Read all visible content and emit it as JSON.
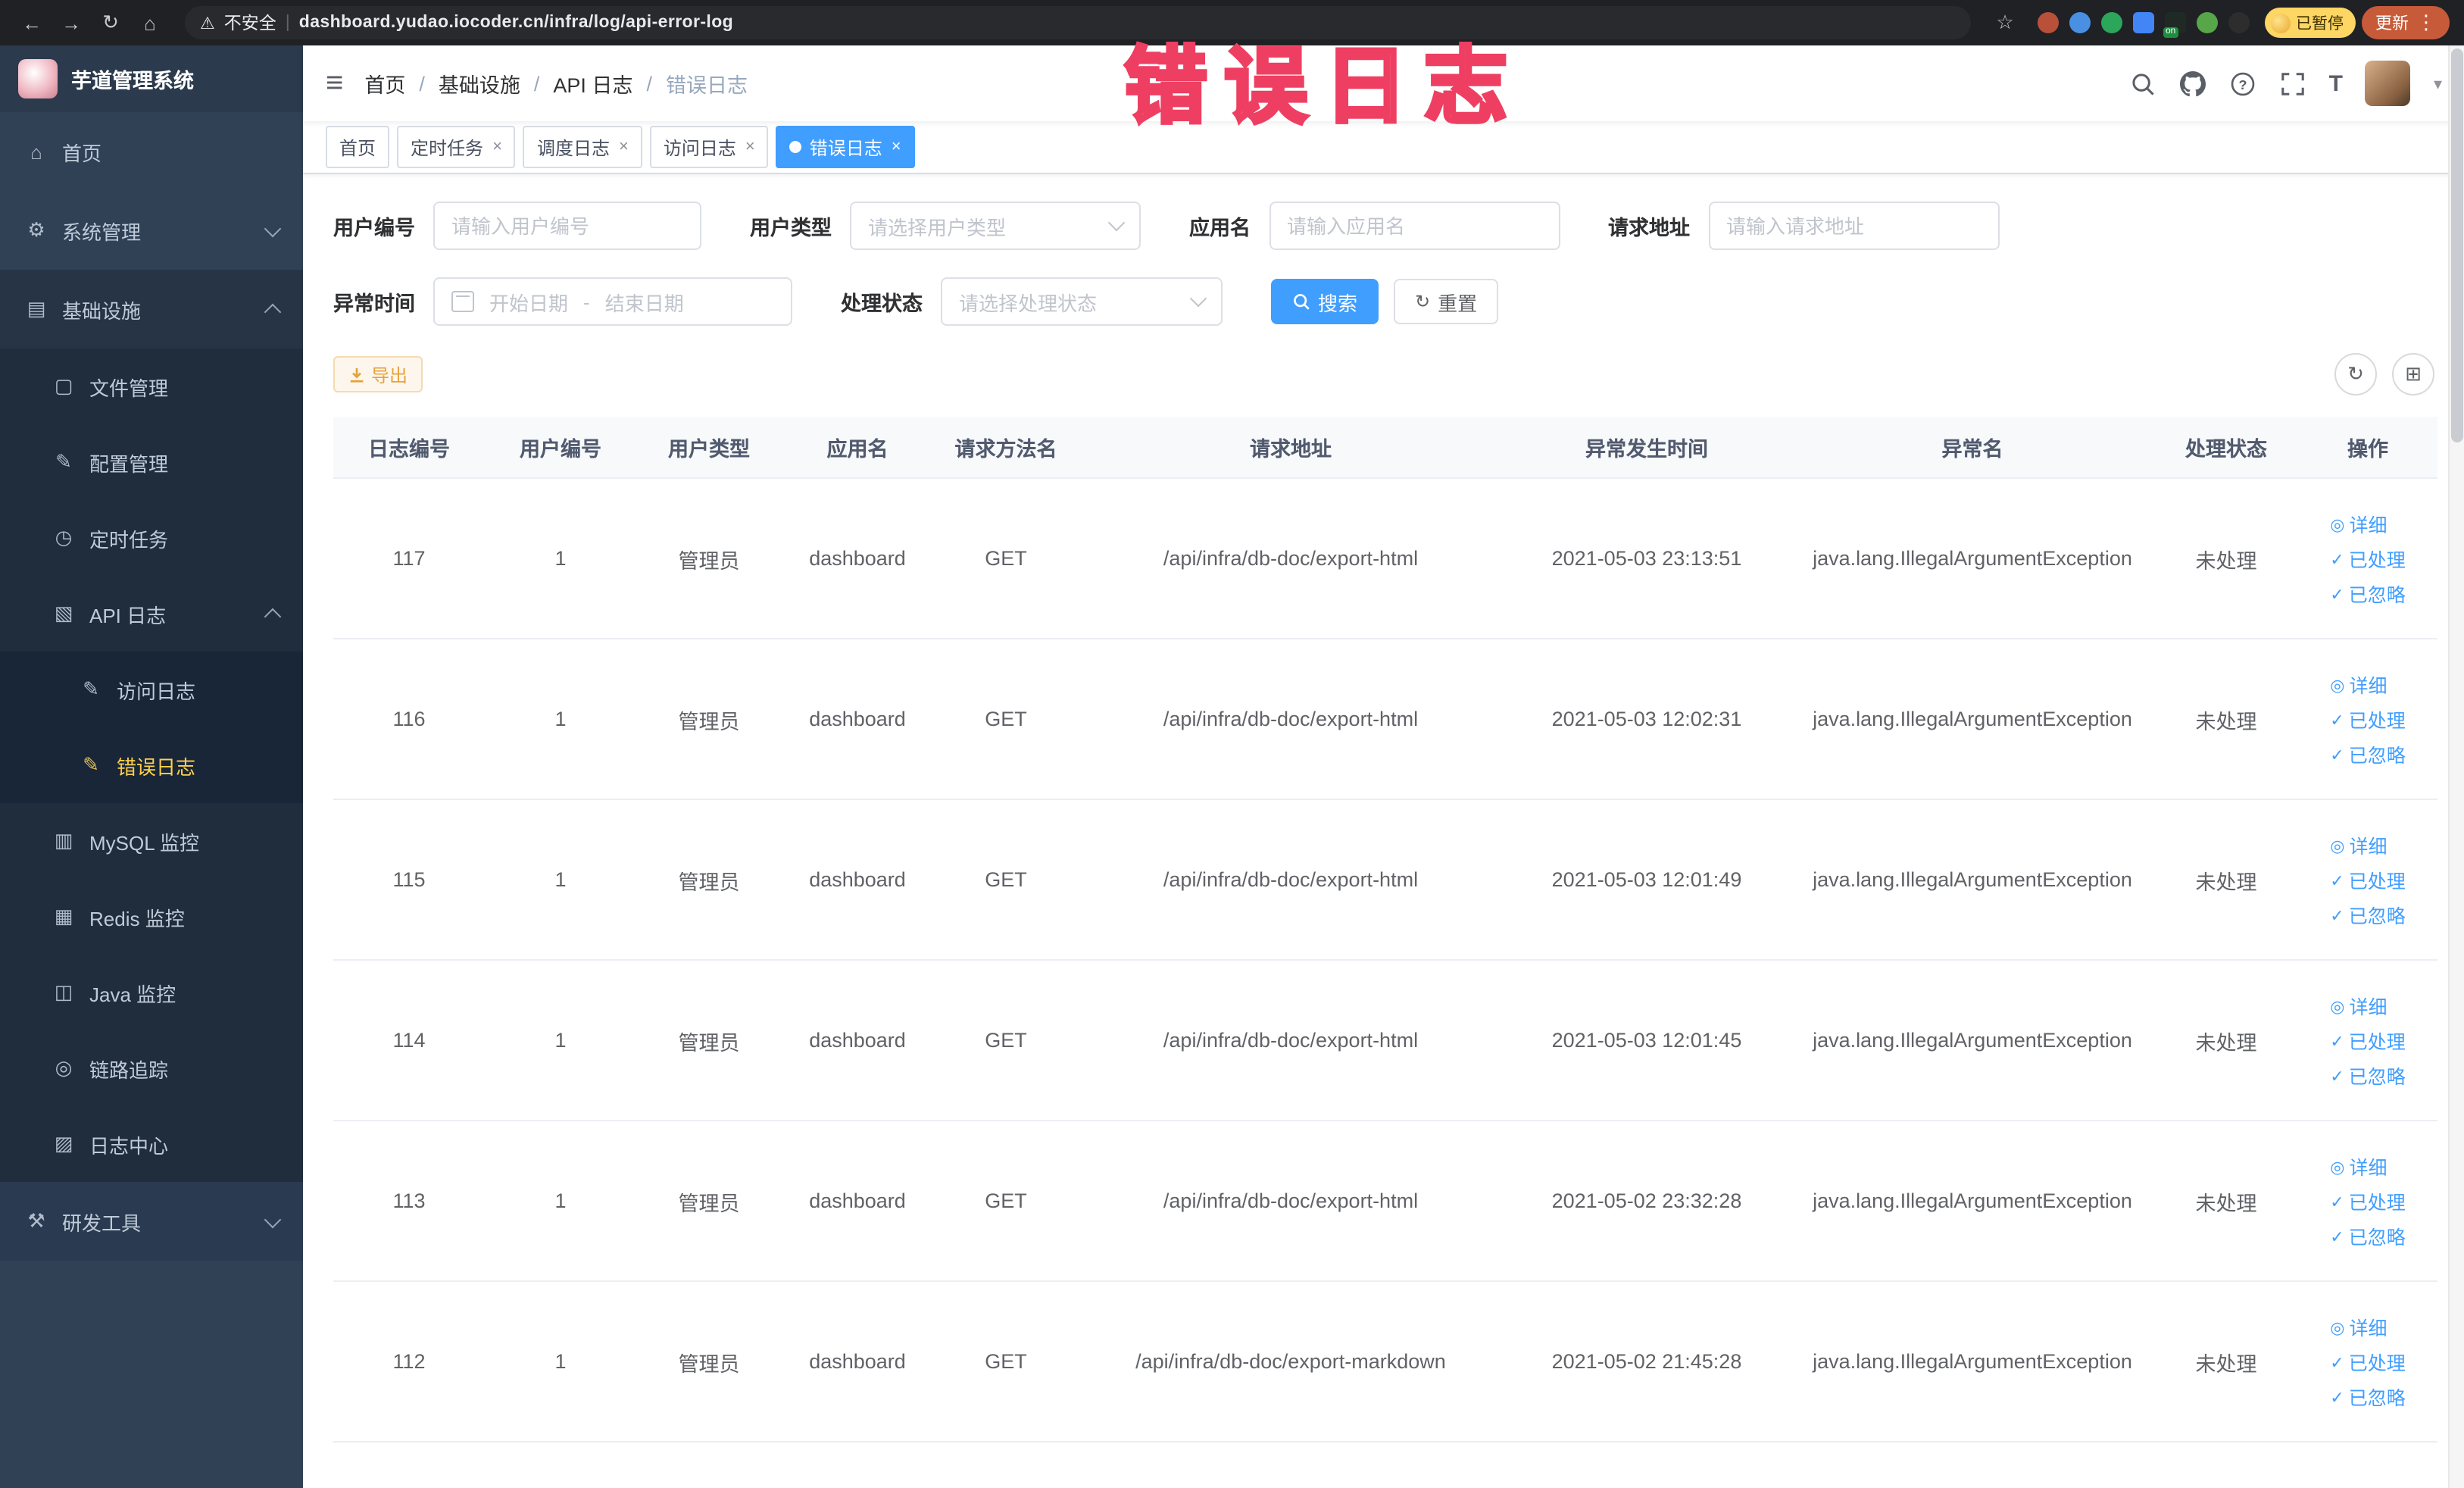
{
  "browser": {
    "security_label": "不安全",
    "url": "dashboard.yudao.iocoder.cn/infra/log/api-error-log",
    "on_badge": "on",
    "paused_badge": "已暂停",
    "update_label": "更新"
  },
  "annotation": {
    "text": "错误日志"
  },
  "sidebar": {
    "title": "芋道管理系统",
    "items": [
      {
        "label": "首页"
      },
      {
        "label": "系统管理"
      },
      {
        "label": "基础设施"
      },
      {
        "label": "文件管理"
      },
      {
        "label": "配置管理"
      },
      {
        "label": "定时任务"
      },
      {
        "label": "API 日志"
      },
      {
        "label": "访问日志"
      },
      {
        "label": "错误日志"
      },
      {
        "label": "MySQL 监控"
      },
      {
        "label": "Redis 监控"
      },
      {
        "label": "Java 监控"
      },
      {
        "label": "链路追踪"
      },
      {
        "label": "日志中心"
      },
      {
        "label": "研发工具"
      }
    ]
  },
  "breadcrumb": [
    "首页",
    "基础设施",
    "API 日志",
    "错误日志"
  ],
  "tags": [
    {
      "label": "首页"
    },
    {
      "label": "定时任务"
    },
    {
      "label": "调度日志"
    },
    {
      "label": "访问日志"
    },
    {
      "label": "错误日志"
    }
  ],
  "filters": {
    "user_id": {
      "label": "用户编号",
      "placeholder": "请输入用户编号"
    },
    "user_type": {
      "label": "用户类型",
      "placeholder": "请选择用户类型"
    },
    "app_name": {
      "label": "应用名",
      "placeholder": "请输入应用名"
    },
    "request_url": {
      "label": "请求地址",
      "placeholder": "请输入请求地址"
    },
    "exception_time": {
      "label": "异常时间",
      "start_placeholder": "开始日期",
      "separator": "-",
      "end_placeholder": "结束日期"
    },
    "process_status": {
      "label": "处理状态",
      "placeholder": "请选择处理状态"
    },
    "search_label": "搜索",
    "reset_label": "重置"
  },
  "toolbar": {
    "export_label": "导出"
  },
  "table": {
    "headers": [
      "日志编号",
      "用户编号",
      "用户类型",
      "应用名",
      "请求方法名",
      "请求地址",
      "异常发生时间",
      "异常名",
      "处理状态",
      "操作"
    ],
    "actions": {
      "detail": "详细",
      "processed": "已处理",
      "ignore": "已忽略"
    },
    "rows": [
      {
        "id": "117",
        "user_id": "1",
        "user_type": "管理员",
        "app": "dashboard",
        "method": "GET",
        "url": "/api/infra/db-doc/export-html",
        "time": "2021-05-03 23:13:51",
        "exception": "java.lang.IllegalArgumentException",
        "status": "未处理"
      },
      {
        "id": "116",
        "user_id": "1",
        "user_type": "管理员",
        "app": "dashboard",
        "method": "GET",
        "url": "/api/infra/db-doc/export-html",
        "time": "2021-05-03 12:02:31",
        "exception": "java.lang.IllegalArgumentException",
        "status": "未处理"
      },
      {
        "id": "115",
        "user_id": "1",
        "user_type": "管理员",
        "app": "dashboard",
        "method": "GET",
        "url": "/api/infra/db-doc/export-html",
        "time": "2021-05-03 12:01:49",
        "exception": "java.lang.IllegalArgumentException",
        "status": "未处理"
      },
      {
        "id": "114",
        "user_id": "1",
        "user_type": "管理员",
        "app": "dashboard",
        "method": "GET",
        "url": "/api/infra/db-doc/export-html",
        "time": "2021-05-03 12:01:45",
        "exception": "java.lang.IllegalArgumentException",
        "status": "未处理"
      },
      {
        "id": "113",
        "user_id": "1",
        "user_type": "管理员",
        "app": "dashboard",
        "method": "GET",
        "url": "/api/infra/db-doc/export-html",
        "time": "2021-05-02 23:32:28",
        "exception": "java.lang.IllegalArgumentException",
        "status": "未处理"
      },
      {
        "id": "112",
        "user_id": "1",
        "user_type": "管理员",
        "app": "dashboard",
        "method": "GET",
        "url": "/api/infra/db-doc/export-markdown",
        "time": "2021-05-02 21:45:28",
        "exception": "java.lang.IllegalArgumentException",
        "status": "未处理"
      }
    ]
  }
}
